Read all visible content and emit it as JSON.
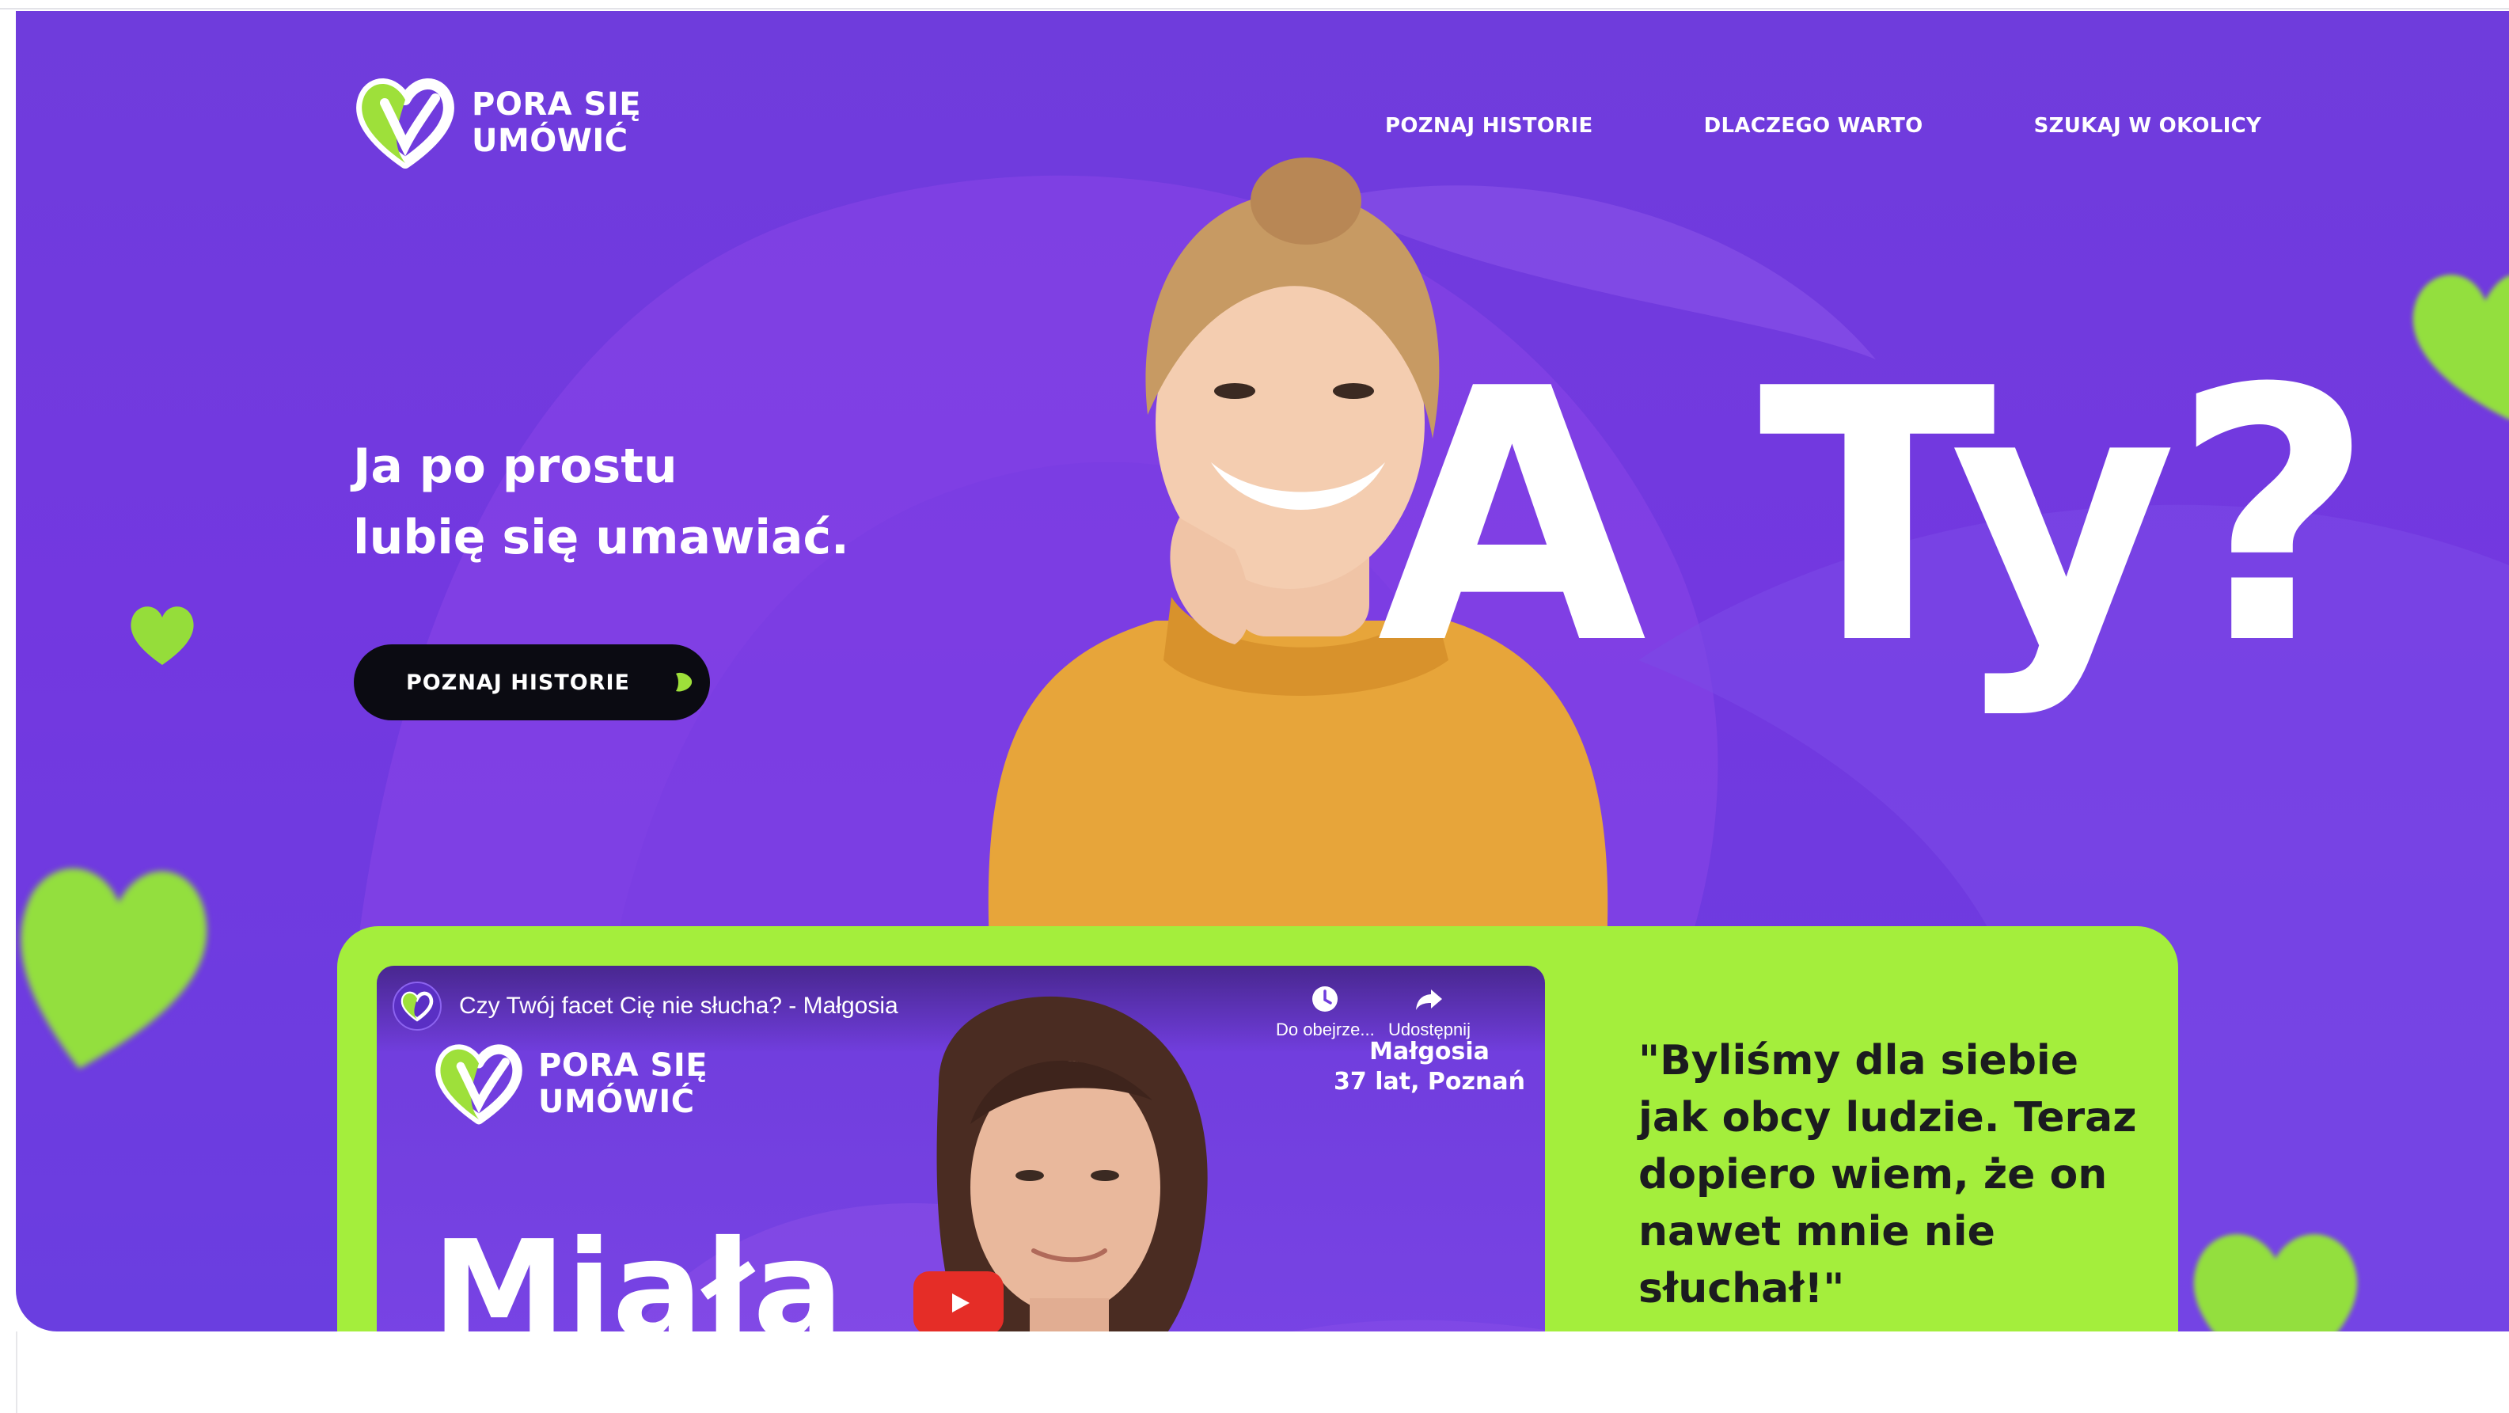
{
  "brand": {
    "line1": "PORA SIĘ",
    "line2": "UMÓWIĆ",
    "colors": {
      "purple": "#7338e0",
      "green": "#a4ee3c",
      "black": "#0b0b12",
      "white": "#ffffff"
    }
  },
  "nav": {
    "items": [
      {
        "label": "POZNAJ HISTORIE"
      },
      {
        "label": "DLACZEGO WARTO"
      },
      {
        "label": "SZUKAJ W OKOLICY"
      }
    ]
  },
  "hero": {
    "headline_line1": "Ja po prostu",
    "headline_line2": "lubię się umawiać.",
    "cta_label": "POZNAJ HISTORIE",
    "big_text": "A Ty?"
  },
  "video": {
    "title": "Czy Twój facet Cię nie słucha? - Małgosia",
    "watch_later_label": "Do obejrze...",
    "share_label": "Udostępnij",
    "person_name": "Małgosia",
    "person_details": "37 lat, Poznań",
    "overlay_text": "Miała",
    "icons": [
      "clock-icon",
      "share-icon",
      "play-icon"
    ]
  },
  "quote": {
    "text": "\"Byliśmy dla siebie jak obcy ludzie. Teraz dopiero wiem, że on nawet mnie nie słuchał!\""
  }
}
